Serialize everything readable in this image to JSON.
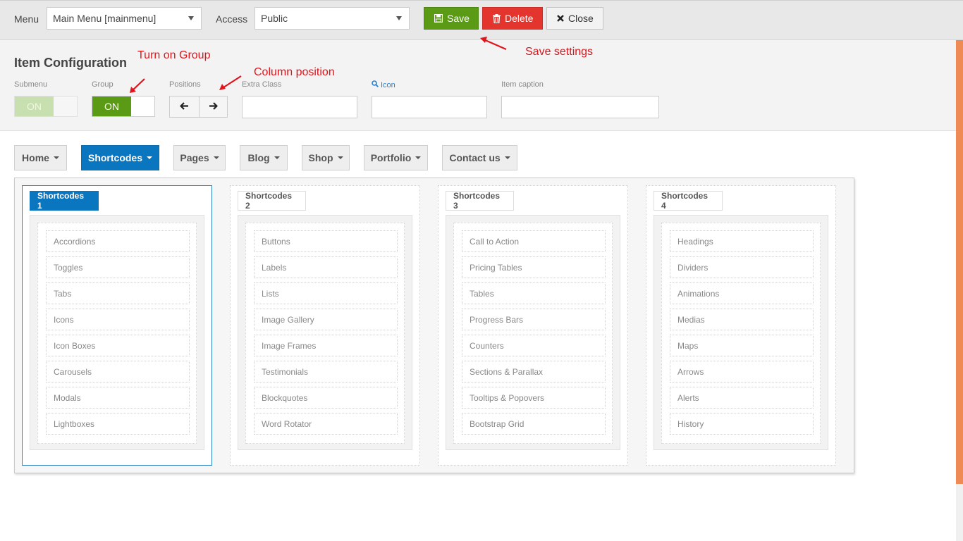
{
  "toolbar": {
    "menu_label": "Menu",
    "menu_value": "Main Menu [mainmenu]",
    "access_label": "Access",
    "access_value": "Public",
    "save_label": "Save",
    "delete_label": "Delete",
    "close_label": "Close"
  },
  "config": {
    "title": "Item Configuration",
    "submenu_label": "Submenu",
    "submenu_toggle": "ON",
    "group_label": "Group",
    "group_toggle": "ON",
    "positions_label": "Positions",
    "extra_class_label": "Extra Class",
    "extra_class_value": "",
    "icon_label": "Icon",
    "icon_value": "",
    "item_caption_label": "Item caption",
    "item_caption_value": ""
  },
  "annotations": {
    "turn_on_group": "Turn on Group",
    "column_position": "Column position",
    "save_settings": "Save settings"
  },
  "nav": [
    {
      "label": "Home"
    },
    {
      "label": "Shortcodes"
    },
    {
      "label": "Pages"
    },
    {
      "label": "Blog"
    },
    {
      "label": "Shop"
    },
    {
      "label": "Portfolio"
    },
    {
      "label": "Contact us"
    }
  ],
  "columns": [
    {
      "title": "Shortcodes 1",
      "items": [
        "Accordions",
        "Toggles",
        "Tabs",
        "Icons",
        "Icon Boxes",
        "Carousels",
        "Modals",
        "Lightboxes"
      ]
    },
    {
      "title": "Shortcodes 2",
      "items": [
        "Buttons",
        "Labels",
        "Lists",
        "Image Gallery",
        "Image Frames",
        "Testimonials",
        "Blockquotes",
        "Word Rotator"
      ]
    },
    {
      "title": "Shortcodes 3",
      "items": [
        "Call to Action",
        "Pricing Tables",
        "Tables",
        "Progress Bars",
        "Counters",
        "Sections & Parallax",
        "Tooltips & Popovers",
        "Bootstrap Grid"
      ]
    },
    {
      "title": "Shortcodes 4",
      "items": [
        "Headings",
        "Dividers",
        "Animations",
        "Medias",
        "Maps",
        "Arrows",
        "Alerts",
        "History"
      ]
    }
  ],
  "colors": {
    "save": "#5a9a14",
    "delete": "#e4342e",
    "active_nav": "#0b76c0",
    "annotation": "#e1141b",
    "scrollbar": "#f08a55"
  }
}
